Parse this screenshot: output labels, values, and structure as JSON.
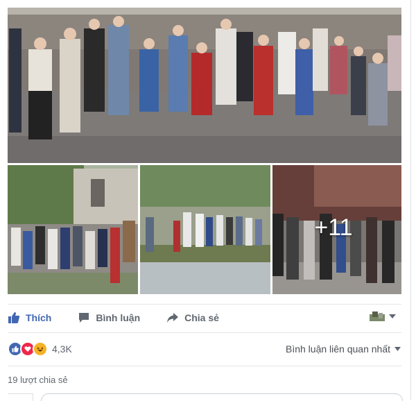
{
  "photos": {
    "more_count": "+11"
  },
  "actions": {
    "like_label": "Thích",
    "comment_label": "Bình luận",
    "share_label": "Chia sẻ"
  },
  "reactions": {
    "count": "4,3K",
    "types": [
      "like-icon",
      "love-icon",
      "haha-icon"
    ]
  },
  "comments": {
    "sort_label": "Bình luận liên quan nhất"
  },
  "shares": {
    "label": "19 lượt chia sẻ"
  },
  "colors": {
    "facebook_blue": "#4267b2",
    "love_red": "#f0284a",
    "haha_yellow": "#f7b125"
  }
}
